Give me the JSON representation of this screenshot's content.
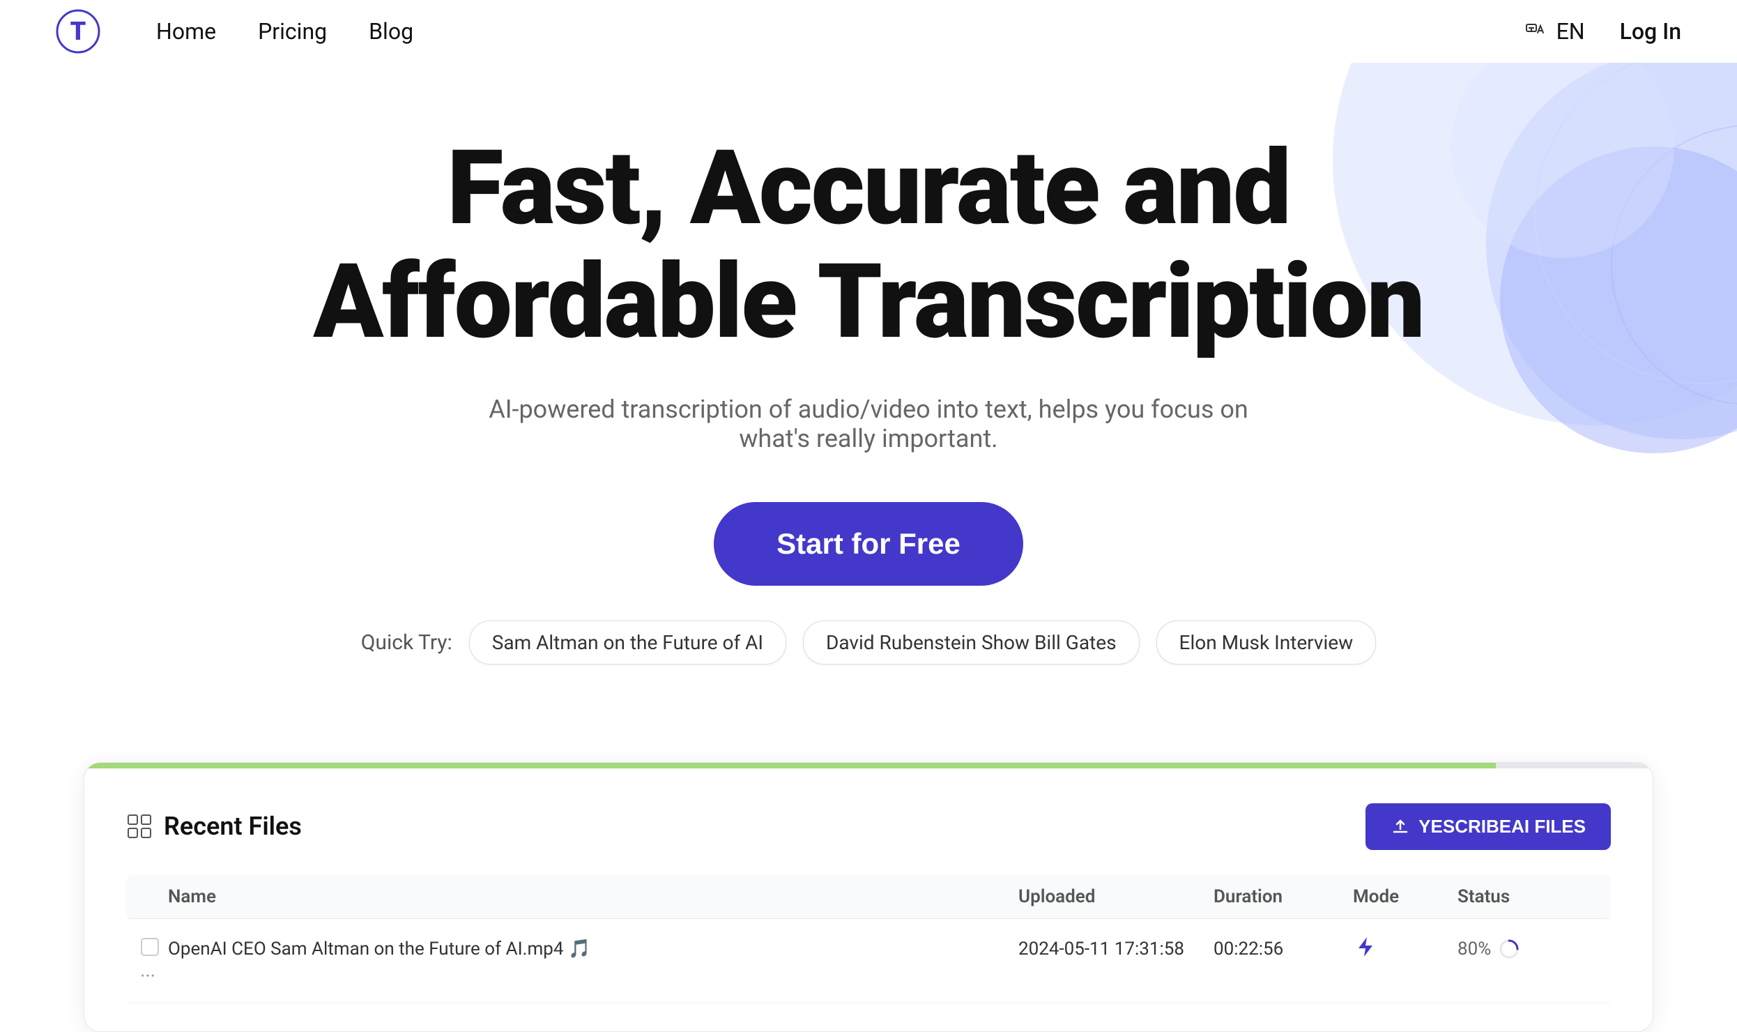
{
  "navbar": {
    "logo_alt": "Transcription App Logo",
    "nav_items": [
      {
        "label": "Home",
        "id": "home"
      },
      {
        "label": "Pricing",
        "id": "pricing"
      },
      {
        "label": "Blog",
        "id": "blog"
      }
    ],
    "lang_label": "EN",
    "login_label": "Log In"
  },
  "hero": {
    "title_line1": "Fast, Accurate and",
    "title_line2": "Affordable Transcription",
    "subtitle": "AI-powered transcription of audio/video into text, helps you focus on what's really important.",
    "cta_label": "Start for Free",
    "quick_try_label": "Quick Try:",
    "quick_tags": [
      {
        "label": "Sam Altman on the Future of AI"
      },
      {
        "label": "David Rubenstein Show Bill Gates"
      },
      {
        "label": "Elon Musk Interview"
      }
    ]
  },
  "dashboard": {
    "recent_files_label": "Recent Files",
    "upload_btn_label": "YESCRIBEAI FILES",
    "table_headers": [
      "",
      "Name",
      "Uploaded",
      "Duration",
      "Mode",
      "Status"
    ],
    "table_rows": [
      {
        "name": "OpenAI CEO Sam Altman on the Future of AI.mp4 🎵",
        "uploaded": "2024-05-11 17:31:58",
        "duration": "00:22:56",
        "mode": "⚡",
        "status": "80%"
      }
    ]
  },
  "colors": {
    "brand_purple": "#4338ca",
    "bg_circle_1": "#c7d2fe",
    "bg_circle_2": "#a5b4fc",
    "bg_circle_3": "#dde4ff",
    "progress_green": "#a3d977"
  }
}
